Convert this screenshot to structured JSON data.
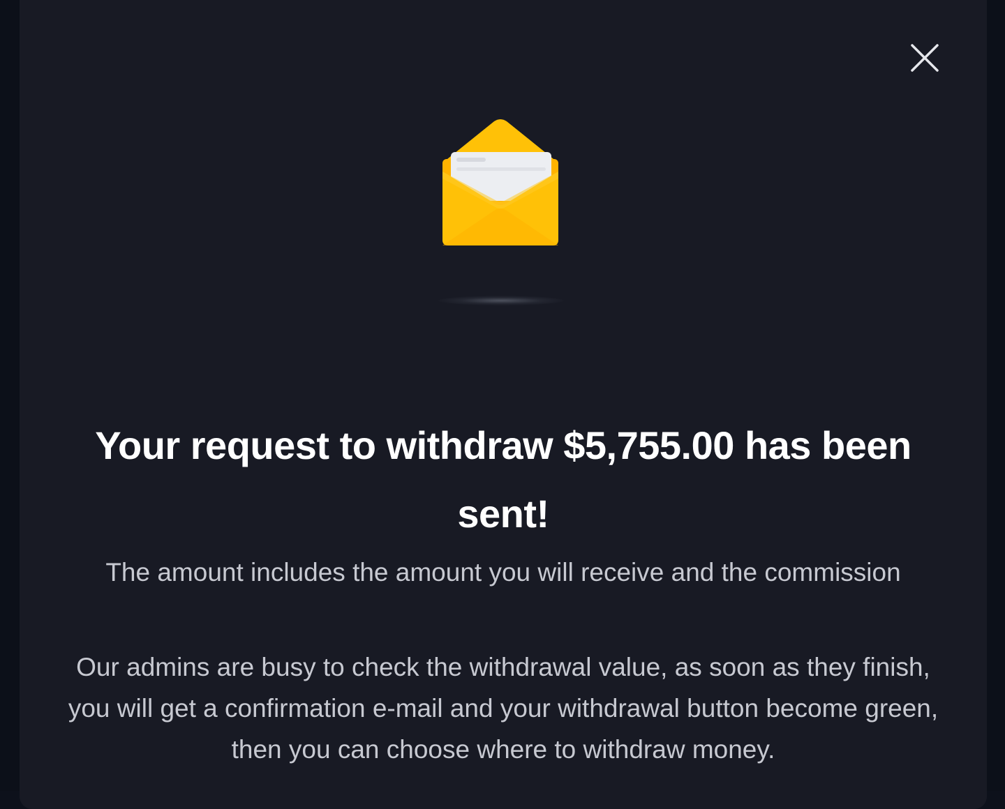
{
  "modal": {
    "close_icon": "close-icon",
    "illustration_icon": "open-envelope-icon",
    "title": "Your request to withdraw $5,755.00 has been sent!",
    "subtitle": "The amount includes the amount you will receive and the commission",
    "info": "Our admins are busy to check the withdrawal value, as soon as they finish, you will get a confirmation e-mail and your withdrawal button become green, then you can choose where to withdraw money."
  },
  "colors": {
    "background": "#0c1019",
    "modal_background": "#181a24",
    "title_text": "#ffffff",
    "body_text": "#c7c9d1",
    "envelope_yellow": "#ffc107"
  }
}
